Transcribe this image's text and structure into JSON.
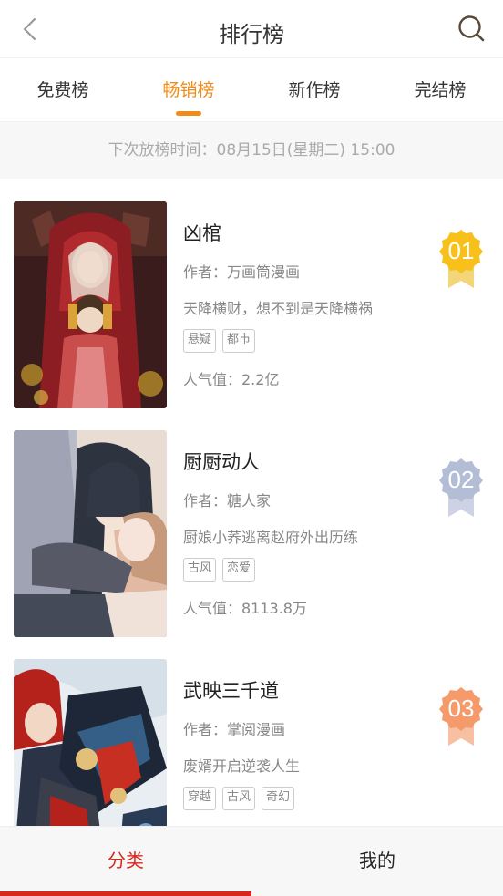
{
  "header": {
    "title": "排行榜",
    "back_icon": "chevron-left-icon",
    "search_icon": "search-icon"
  },
  "tabs": [
    {
      "label": "免费榜",
      "active": false
    },
    {
      "label": "畅销榜",
      "active": true
    },
    {
      "label": "新作榜",
      "active": false
    },
    {
      "label": "完结榜",
      "active": false
    }
  ],
  "next_release": "下次放榜时间：08月15日(星期二) 15:00",
  "colors": {
    "accent": "#f08c1a",
    "nav_active": "#d9271d",
    "rank_gold": "#f7c01a",
    "rank_silver": "#b4bdd6",
    "rank_bronze": "#f59a6b"
  },
  "comics": [
    {
      "title": "凶棺",
      "author": "作者：万画筒漫画",
      "description": "天降横财，想不到是天降横祸",
      "tags": [
        "悬疑",
        "都市"
      ],
      "popularity": "人气值：2.2亿",
      "rank": "01"
    },
    {
      "title": "厨厨动人",
      "author": "作者：糖人家",
      "description": "厨娘小荞逃离赵府外出历练",
      "tags": [
        "古风",
        "恋爱"
      ],
      "popularity": "人气值：8113.8万",
      "rank": "02"
    },
    {
      "title": "武映三千道",
      "author": "作者：掌阅漫画",
      "description": "废婿开启逆袭人生",
      "tags": [
        "穿越",
        "古风",
        "奇幻"
      ],
      "popularity": "",
      "rank": "03"
    }
  ],
  "bottom_nav": [
    {
      "label": "分类",
      "active": true
    },
    {
      "label": "我的",
      "active": false
    }
  ]
}
